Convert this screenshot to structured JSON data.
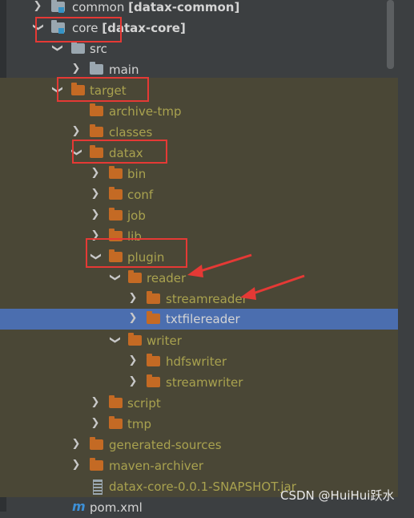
{
  "project_tree": {
    "items": [
      {
        "label": "common",
        "module": "[datax-common]"
      },
      {
        "label": "core",
        "module": "[datax-core]"
      },
      {
        "label": "src"
      },
      {
        "label": "main"
      },
      {
        "label": "target"
      },
      {
        "label": "archive-tmp"
      },
      {
        "label": "classes"
      },
      {
        "label": "datax"
      },
      {
        "label": "bin"
      },
      {
        "label": "conf"
      },
      {
        "label": "job"
      },
      {
        "label": "lib"
      },
      {
        "label": "plugin"
      },
      {
        "label": "reader"
      },
      {
        "label": "streamreader"
      },
      {
        "label": "txtfilereader"
      },
      {
        "label": "writer"
      },
      {
        "label": "hdfswriter"
      },
      {
        "label": "streamwriter"
      },
      {
        "label": "script"
      },
      {
        "label": "tmp"
      },
      {
        "label": "generated-sources"
      },
      {
        "label": "maven-archiver"
      },
      {
        "label": "datax-core-0.0.1-SNAPSHOT.jar"
      },
      {
        "label": "pom.xml"
      }
    ]
  },
  "selected_item": "txtfilereader",
  "watermark": "CSDN @HuiHui跃水",
  "colors": {
    "background": "#3c3f41",
    "excluded_background": "#4a4736",
    "selection": "#4b6eaf",
    "folder_orange": "#c46a24",
    "folder_gray": "#9aa7b0",
    "excluded_text": "#a9a24f",
    "annotation_red": "#e53935"
  },
  "icons": [
    "chevron-right-icon",
    "chevron-down-icon",
    "folder-icon",
    "excluded-folder-icon",
    "module-folder-icon",
    "jar-icon",
    "maven-icon"
  ]
}
